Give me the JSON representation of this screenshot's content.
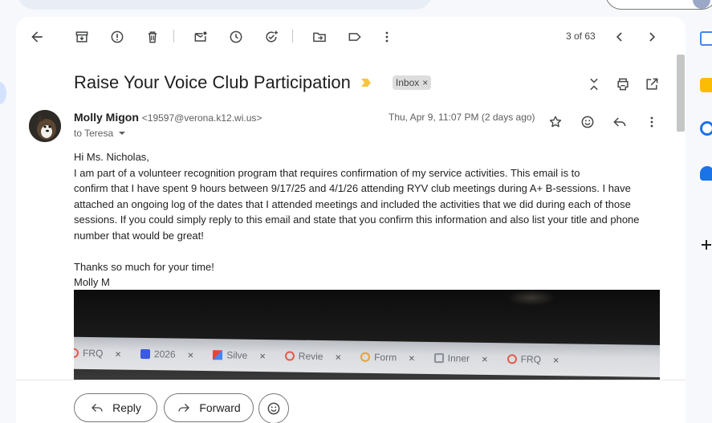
{
  "toolbar": {
    "pager": "3 of 63"
  },
  "email": {
    "subject": "Raise Your Voice Club Participation",
    "label": "Inbox",
    "label_remove": "×",
    "sender_name": "Molly Migon",
    "sender_email": "<19597@verona.k12.wi.us>",
    "to": "to Teresa",
    "date": "Thu, Apr 9, 11:07 PM (2 days ago)",
    "body": {
      "greeting": "Hi Ms. Nicholas,",
      "line1": "I am part of a volunteer recognition program that requires confirmation of my service activities. This email is to",
      "paragraph": "confirm that I have spent 9 hours between 9/17/25 and 4/1/26 attending RYV club meetings during A+ B-sessions. I have attached an ongoing log of the dates that I attended meetings and included the activities that we did during each of those sessions. If you could simply reply to this email and state that you confirm this information and also list your title and phone number that would be great!",
      "thanks": "Thanks so much for your time!",
      "signature": "Molly M"
    }
  },
  "attachment": {
    "tabs": [
      {
        "label": "FRQ",
        "icon": "red-ring"
      },
      {
        "label": "2026",
        "icon": "blue-square"
      },
      {
        "label": "Silve",
        "icon": "gmail"
      },
      {
        "label": "Revie",
        "icon": "red-ring"
      },
      {
        "label": "Form",
        "icon": "orange-ring"
      },
      {
        "label": "Inner",
        "icon": "gray-square"
      },
      {
        "label": "FRQ",
        "icon": "red-ring"
      }
    ]
  },
  "actions": {
    "reply": "Reply",
    "forward": "Forward"
  }
}
